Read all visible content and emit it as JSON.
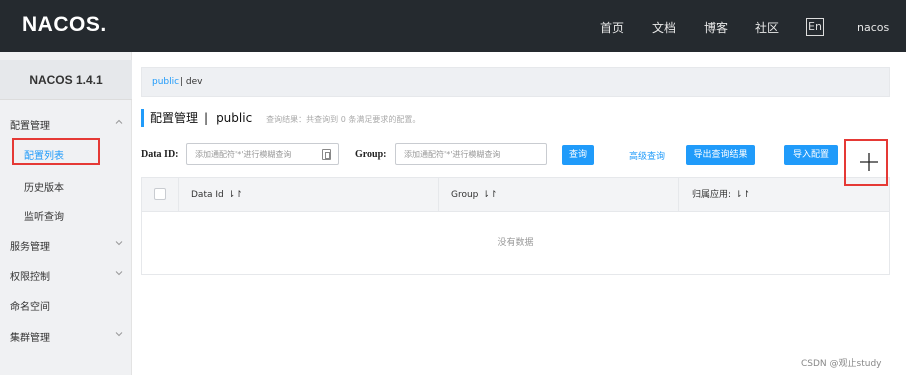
{
  "header": {
    "logo": "NACOS.",
    "nav": [
      "首页",
      "文档",
      "博客",
      "社区"
    ],
    "lang": "En",
    "user": "nacos"
  },
  "sidebar": {
    "title": "NACOS 1.4.1",
    "items": [
      {
        "label": "配置管理",
        "expanded": true
      },
      {
        "label": "配置列表",
        "active": true
      },
      {
        "label": "历史版本"
      },
      {
        "label": "监听查询"
      },
      {
        "label": "服务管理"
      },
      {
        "label": "权限控制"
      },
      {
        "label": "命名空间"
      },
      {
        "label": "集群管理"
      }
    ]
  },
  "namespace": {
    "public": "public",
    "dev": "| dev"
  },
  "page": {
    "title": "配置管理",
    "sep": "|",
    "namespace": "public",
    "hint": "查询结果：共查询到 0 条满足要求的配置。"
  },
  "search": {
    "data_id_label": "Data ID:",
    "data_id_placeholder": "添加通配符'*'进行模糊查询",
    "group_label": "Group:",
    "group_placeholder": "添加通配符'*'进行模糊查询",
    "query_button": "查询",
    "advanced_link": "高级查询",
    "export_button": "导出查询结果",
    "import_button": "导入配置"
  },
  "table": {
    "columns": [
      "Data Id",
      "Group",
      "归属应用:"
    ],
    "sort_glyph": "⇂↾",
    "empty": "没有数据"
  },
  "watermark": "CSDN @观止study",
  "colors": {
    "accent": "#209bfa",
    "topbar": "#252a2f",
    "highlight": "#e53935"
  }
}
